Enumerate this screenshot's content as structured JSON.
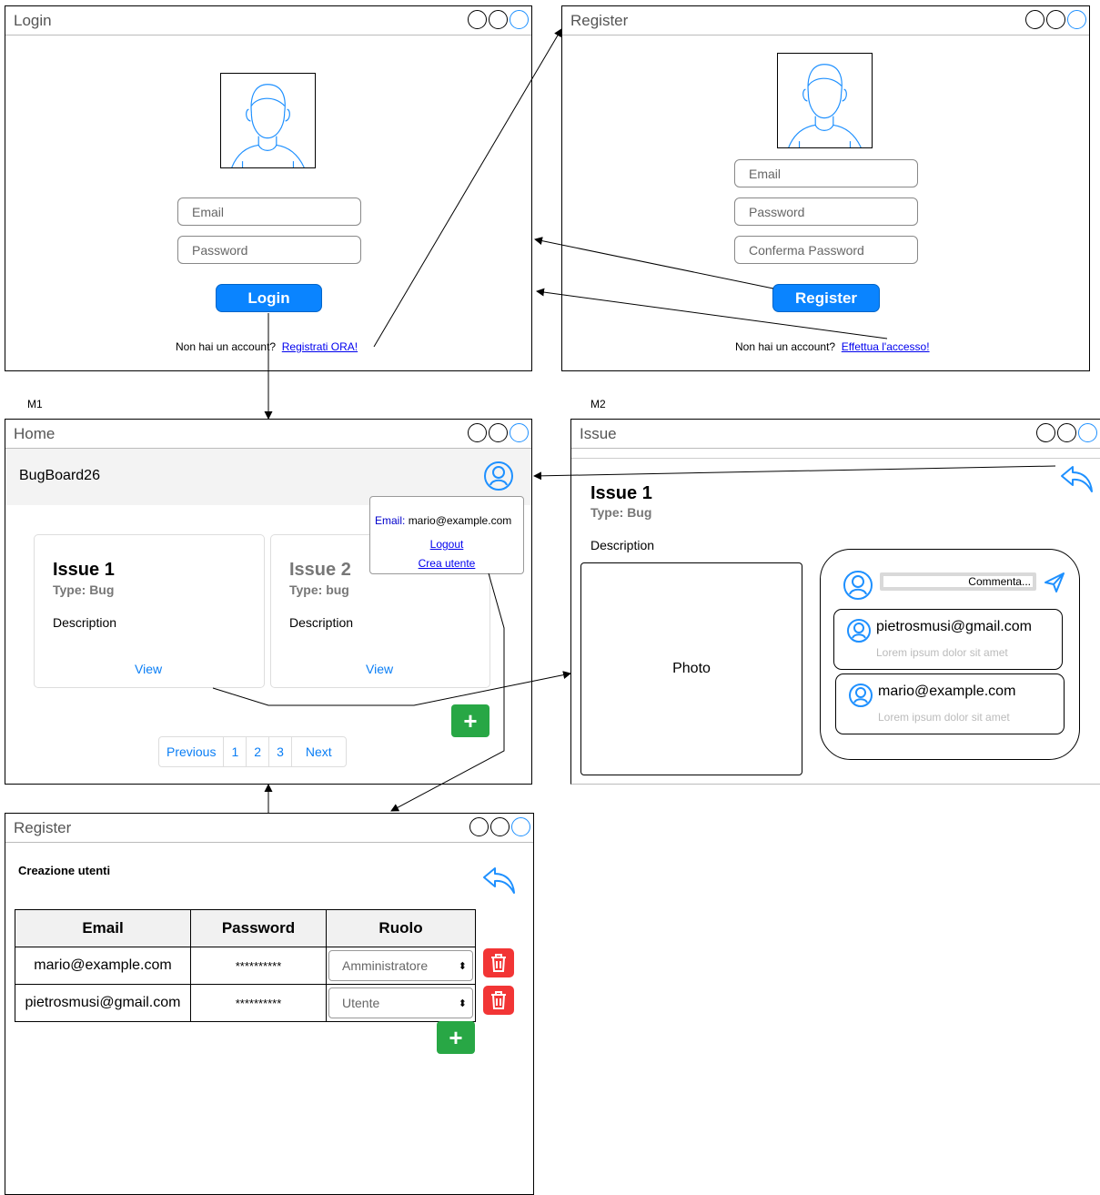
{
  "login": {
    "title": "Login",
    "email_placeholder": "Email",
    "password_placeholder": "Password",
    "button": "Login",
    "footer_text": "Non hai un account?",
    "footer_link": "Registrati ORA!"
  },
  "register": {
    "title": "Register",
    "email_placeholder": "Email",
    "password_placeholder": "Password",
    "confirm_placeholder": "Conferma Password",
    "button": "Register",
    "footer_text": "Non hai un account?",
    "footer_link": "Effettua l'accesso!"
  },
  "labels": {
    "m1": "M1",
    "m2": "M2"
  },
  "home": {
    "title": "Home",
    "app_name": "BugBoard26",
    "popup": {
      "email_label": "Email:",
      "email_value": "mario@example.com",
      "logout": "Logout",
      "create_user": "Crea utente"
    },
    "cards": [
      {
        "title": "Issue 1",
        "type": "Type: Bug",
        "description": "Description",
        "view": "View"
      },
      {
        "title": "Issue 2",
        "type": "Type: bug",
        "description": "Description",
        "view": "View"
      }
    ],
    "pagination": [
      "Previous",
      "1",
      "2",
      "3",
      "Next"
    ],
    "add_label": "+"
  },
  "issue": {
    "title": "Issue",
    "issue_title": "Issue 1",
    "type": "Type: Bug",
    "description": "Description",
    "photo": "Photo",
    "comment_placeholder": "Commenta...",
    "comments": [
      {
        "email": "pietrosmusi@gmail.com",
        "text": "Lorem ipsum dolor sit amet"
      },
      {
        "email": "mario@example.com",
        "text": "Lorem ipsum dolor sit amet"
      }
    ]
  },
  "users": {
    "title": "Register",
    "heading": "Creazione utenti",
    "columns": [
      "Email",
      "Password",
      "Ruolo"
    ],
    "rows": [
      {
        "email": "mario@example.com",
        "password": "**********",
        "role": "Amministratore"
      },
      {
        "email": "pietrosmusi@gmail.com",
        "password": "**********",
        "role": "Utente"
      }
    ],
    "add_label": "+"
  },
  "colors": {
    "primary_blue": "#0a84ff",
    "icon_blue": "#1e90ff",
    "link_blue": "#0a7ef5",
    "add_green": "#28a745",
    "delete_red": "#f23535"
  }
}
